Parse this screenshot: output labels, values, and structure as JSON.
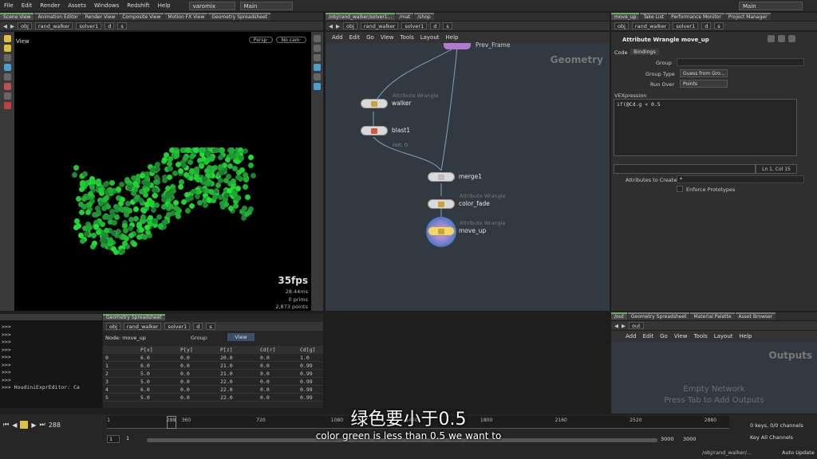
{
  "menubar": {
    "items": [
      "File",
      "Edit",
      "Render",
      "Assets",
      "Windows",
      "Redshift",
      "Help"
    ],
    "desktop": "varomix",
    "main_label": "Main",
    "right_main": "Main"
  },
  "left_tabs": [
    "Scene View",
    "Animation Editor",
    "Render View",
    "Composite View",
    "Motion FX View",
    "Geometry Spreadsheet"
  ],
  "left_path": [
    "obj",
    "rand_walker",
    "solver1",
    "d",
    "s"
  ],
  "viewport": {
    "title": "View",
    "persp": "Persp·",
    "cam": "No cam·",
    "fps": "35fps",
    "ms": "28.44ms",
    "prims": "0 prims",
    "points": "2,873 points"
  },
  "mid_tabs": [
    "/obj/rand_walker/solver1...",
    "/mat",
    "/shop"
  ],
  "mid_path": [
    "obj",
    "rand_walker",
    "solver1",
    "d",
    "s"
  ],
  "mid_menu": [
    "Add",
    "Edit",
    "Go",
    "View",
    "Tools",
    "Layout",
    "Help"
  ],
  "network": {
    "context": "Geometry",
    "top_node": "Prev_Frame",
    "nodes": [
      {
        "type": "Attribute Wrangle",
        "name": "walker"
      },
      {
        "type": "",
        "name": "blast1",
        "sub": "not: 0"
      },
      {
        "type": "",
        "name": "merge1"
      },
      {
        "type": "Attribute Wrangle",
        "name": "color_fade"
      },
      {
        "type": "Attribute Wrangle",
        "name": "move_up"
      }
    ]
  },
  "right_tabs": [
    "move_up",
    "Take List",
    "Performance Monitor",
    "Project Manager"
  ],
  "right_path": [
    "obj",
    "rand_walker",
    "solver1",
    "d",
    "s"
  ],
  "params": {
    "title": "Attribute Wrangle  move_up",
    "tab_code": "Code",
    "tab_bindings": "Bindings",
    "group_label": "Group",
    "group_type_label": "Group Type",
    "group_type_value": "Guess from Gro...",
    "run_over_label": "Run Over",
    "run_over_value": "Points",
    "vex_label": "VEXpression",
    "vex_code": "if(@Cd.g < 0.5",
    "cursor": "Ln 1, Col 15",
    "attr_create_label": "Attributes to Create",
    "attr_create_value": "*",
    "enforce": "Enforce Prototypes"
  },
  "out_tabs": [
    "/out",
    "Geometry Spreadsheet",
    "Material Palette",
    "Asset Browser"
  ],
  "out_path": "out",
  "out_menu": [
    "Add",
    "Edit",
    "Go",
    "View",
    "Tools",
    "Layout",
    "Help"
  ],
  "outputs": {
    "title": "Outputs",
    "empty": "Empty Network",
    "hint": "Press Tab to Add Outputs"
  },
  "console": {
    "lines": [
      ">>>",
      ">>>",
      ">>>",
      ">>>",
      ">>>",
      ">>>",
      ">>>",
      ">>>",
      ">>> HoudiniExprEditor: Ca"
    ]
  },
  "spreadsheet": {
    "tab": "Geometry Spreadsheet",
    "path": [
      "obj",
      "rand_walker",
      "solver1",
      "d",
      "s"
    ],
    "node_label": "Node: move_up",
    "group_label": "Group:",
    "view_label": "View",
    "columns": [
      "",
      "P[x]",
      "P[y]",
      "P[z]",
      "Cd[r]",
      "Cd[g]"
    ],
    "rows": [
      [
        "0",
        "6.0",
        "0.0",
        "20.0",
        "0.0",
        "1.0"
      ],
      [
        "1",
        "6.0",
        "0.0",
        "21.0",
        "0.0",
        "0.99"
      ],
      [
        "2",
        "5.0",
        "0.0",
        "21.0",
        "0.0",
        "0.99"
      ],
      [
        "3",
        "5.0",
        "0.0",
        "22.0",
        "0.0",
        "0.99"
      ],
      [
        "4",
        "6.0",
        "0.0",
        "22.0",
        "0.0",
        "0.99"
      ],
      [
        "5",
        "5.0",
        "0.0",
        "22.0",
        "0.0",
        "0.99"
      ]
    ]
  },
  "timeline": {
    "frame": "288",
    "ticks": [
      "1",
      "288",
      "360",
      "720",
      "1080",
      "1440",
      "1800",
      "2160",
      "2520",
      "2880"
    ],
    "start": "1",
    "start2": "1",
    "end": "3000",
    "end2": "3000",
    "keys": "0 keys, 0/0 channels",
    "key_all": "Key All Channels",
    "auto_update": "Auto Update",
    "path": "/obj/rand_walker/..."
  },
  "subtitle": {
    "zh": "绿色要小于0.5",
    "en": "color green is less than 0.5 we want to"
  },
  "colors": {
    "accent": "#6aa86a",
    "node_selected": "#f5d86b",
    "green": "#2fd24a"
  }
}
